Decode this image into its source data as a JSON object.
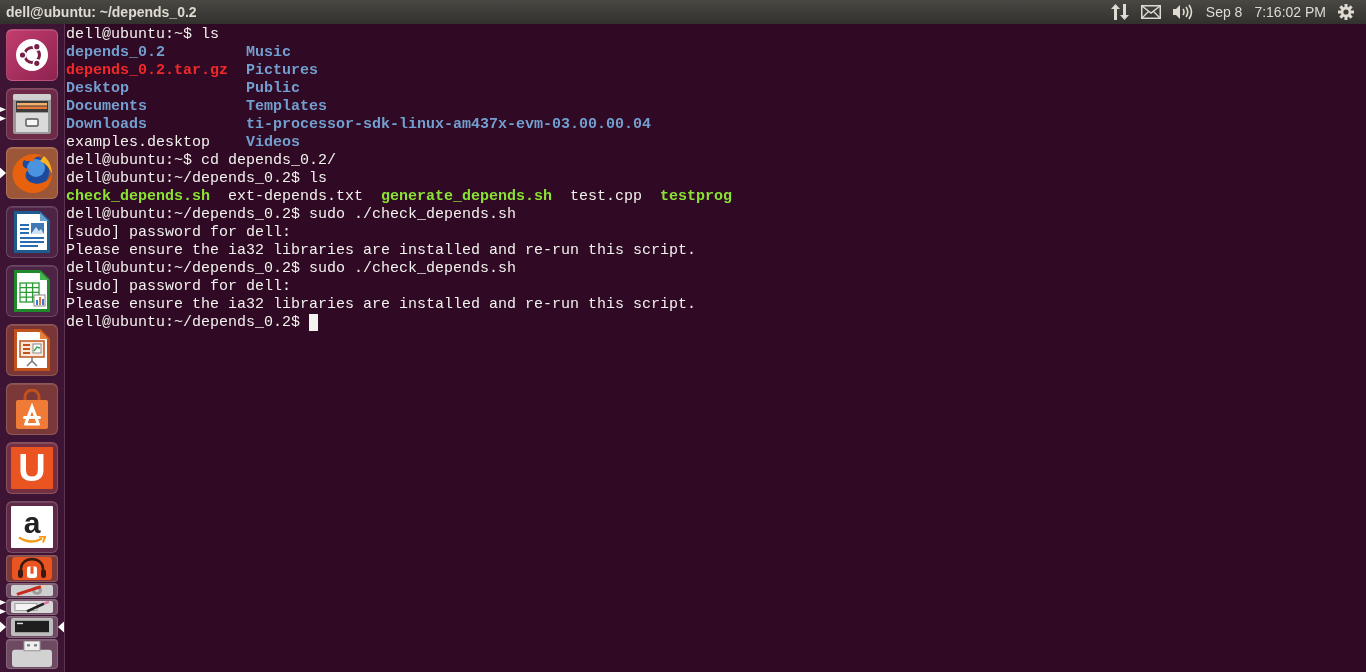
{
  "top_panel": {
    "title": "dell@ubuntu: ~/depends_0.2",
    "date": "Sep 8",
    "time": "7:16:02 PM"
  },
  "launcher": {
    "items": [
      {
        "kind": "dash",
        "running": false,
        "multiple_windows": false,
        "focused": false,
        "folded": false
      },
      {
        "kind": "files",
        "running": true,
        "multiple_windows": true,
        "focused": false,
        "folded": false
      },
      {
        "kind": "browser",
        "running": true,
        "multiple_windows": false,
        "focused": false,
        "folded": false
      },
      {
        "kind": "document",
        "running": false,
        "multiple_windows": false,
        "focused": false,
        "folded": false
      },
      {
        "kind": "spreadsheet",
        "running": false,
        "multiple_windows": false,
        "focused": false,
        "folded": false
      },
      {
        "kind": "presentation",
        "running": false,
        "multiple_windows": false,
        "focused": false,
        "folded": false
      },
      {
        "kind": "store",
        "running": false,
        "multiple_windows": false,
        "focused": false,
        "folded": false
      },
      {
        "kind": "cloud",
        "label": "U",
        "running": false,
        "multiple_windows": false,
        "focused": false,
        "folded": false
      },
      {
        "kind": "shopping",
        "label": "a",
        "running": false,
        "multiple_windows": false,
        "focused": false,
        "folded": false
      },
      {
        "kind": "music",
        "running": false,
        "multiple_windows": false,
        "focused": false,
        "folded": true
      },
      {
        "kind": "settings",
        "running": false,
        "multiple_windows": false,
        "focused": false,
        "folded": true
      },
      {
        "kind": "drawing",
        "running": true,
        "multiple_windows": true,
        "focused": false,
        "folded": true
      },
      {
        "kind": "terminal",
        "running": true,
        "multiple_windows": false,
        "focused": true,
        "folded": true
      },
      {
        "kind": "drive",
        "running": false,
        "multiple_windows": false,
        "focused": false,
        "folded": true
      }
    ]
  },
  "terminal": {
    "cursor": true,
    "lines": [
      {
        "kind": "text",
        "text": "dell@ubuntu:~$ ls"
      },
      {
        "kind": "listing",
        "entries": [
          {
            "name": "depends_0.2",
            "kind": "directory"
          },
          {
            "name": "Music",
            "kind": "directory"
          }
        ]
      },
      {
        "kind": "listing",
        "entries": [
          {
            "name": "depends_0.2.tar.gz",
            "kind": "archive"
          },
          {
            "name": "Pictures",
            "kind": "directory"
          }
        ]
      },
      {
        "kind": "listing",
        "entries": [
          {
            "name": "Desktop",
            "kind": "directory"
          },
          {
            "name": "Public",
            "kind": "directory"
          }
        ]
      },
      {
        "kind": "listing",
        "entries": [
          {
            "name": "Documents",
            "kind": "directory"
          },
          {
            "name": "Templates",
            "kind": "directory"
          }
        ]
      },
      {
        "kind": "listing",
        "entries": [
          {
            "name": "Downloads",
            "kind": "directory"
          },
          {
            "name": "ti-processor-sdk-linux-am437x-evm-03.00.00.04",
            "kind": "directory"
          }
        ]
      },
      {
        "kind": "listing",
        "entries": [
          {
            "name": "examples.desktop",
            "kind": "file"
          },
          {
            "name": "Videos",
            "kind": "directory"
          }
        ]
      },
      {
        "kind": "text",
        "text": "dell@ubuntu:~$ cd depends_0.2/"
      },
      {
        "kind": "text",
        "text": "dell@ubuntu:~/depends_0.2$ ls"
      },
      {
        "kind": "listing",
        "entries": [
          {
            "name": "check_depends.sh",
            "kind": "executable"
          },
          {
            "name": "ext-depends.txt",
            "kind": "file"
          },
          {
            "name": "generate_depends.sh",
            "kind": "executable"
          },
          {
            "name": "test.cpp",
            "kind": "file"
          },
          {
            "name": "testprog",
            "kind": "executable"
          }
        ]
      },
      {
        "kind": "text",
        "text": "dell@ubuntu:~/depends_0.2$ sudo ./check_depends.sh"
      },
      {
        "kind": "text",
        "text": "[sudo] password for dell:"
      },
      {
        "kind": "text",
        "text": "Please ensure the ia32 libraries are installed and re-run this script."
      },
      {
        "kind": "text",
        "text": "dell@ubuntu:~/depends_0.2$ sudo ./check_depends.sh"
      },
      {
        "kind": "text",
        "text": "[sudo] password for dell:"
      },
      {
        "kind": "text",
        "text": "Please ensure the ia32 libraries are installed and re-run this script."
      },
      {
        "kind": "text",
        "text": "dell@ubuntu:~/depends_0.2$"
      }
    ]
  }
}
